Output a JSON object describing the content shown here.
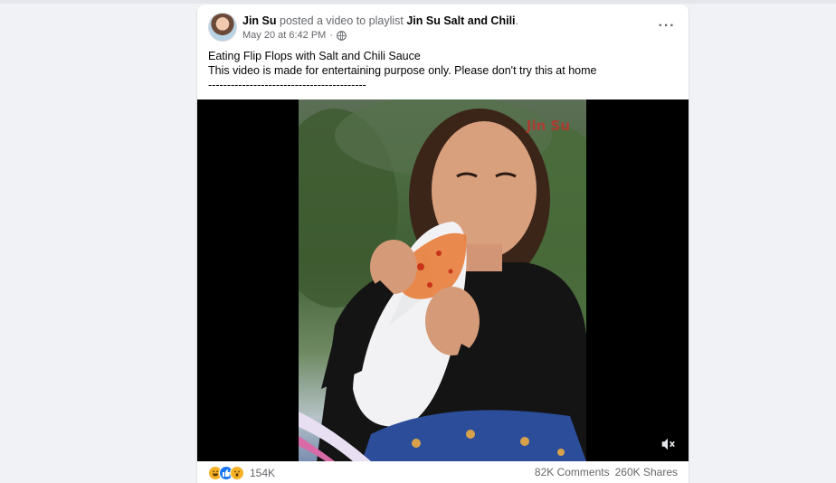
{
  "post": {
    "author": "Jin Su",
    "action_text": " posted a video to playlist ",
    "playlist": "Jin Su Salt and Chili",
    "playlist_suffix": ".",
    "timestamp": "May 20 at 6:42 PM",
    "timestamp_separator": "·",
    "privacy_icon": "globe-icon",
    "more_icon": "more-options-icon",
    "more_label": "···",
    "caption_lines": [
      "Eating Flip Flops with Salt and Chili Sauce",
      "This video is made for entertaining purpose only. Please don't try this at home",
      "------------------------------------------"
    ]
  },
  "video": {
    "watermark": "Jin Su",
    "sound_icon": "muted-speaker-icon"
  },
  "footer": {
    "reaction_icons": [
      "haha-reaction-icon",
      "like-reaction-icon",
      "wow-reaction-icon"
    ],
    "reaction_count": "154K",
    "comments": "82K Comments",
    "shares": "260K Shares"
  },
  "colors": {
    "page_bg": "#f0f2f5",
    "card_bg": "#ffffff",
    "secondary_text": "#65676b",
    "like_blue": "#1877f2",
    "reaction_yellow": "#f7b125"
  }
}
